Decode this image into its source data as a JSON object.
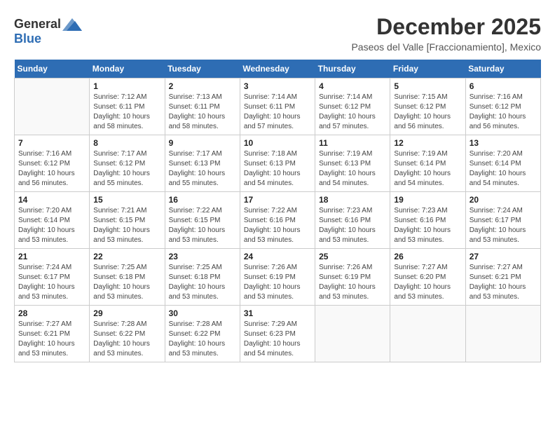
{
  "logo": {
    "general": "General",
    "blue": "Blue"
  },
  "title": "December 2025",
  "subtitle": "Paseos del Valle [Fraccionamiento], Mexico",
  "weekdays": [
    "Sunday",
    "Monday",
    "Tuesday",
    "Wednesday",
    "Thursday",
    "Friday",
    "Saturday"
  ],
  "weeks": [
    [
      {
        "day": "",
        "sunrise": "",
        "sunset": "",
        "daylight": ""
      },
      {
        "day": "1",
        "sunrise": "Sunrise: 7:12 AM",
        "sunset": "Sunset: 6:11 PM",
        "daylight": "Daylight: 10 hours and 58 minutes."
      },
      {
        "day": "2",
        "sunrise": "Sunrise: 7:13 AM",
        "sunset": "Sunset: 6:11 PM",
        "daylight": "Daylight: 10 hours and 58 minutes."
      },
      {
        "day": "3",
        "sunrise": "Sunrise: 7:14 AM",
        "sunset": "Sunset: 6:11 PM",
        "daylight": "Daylight: 10 hours and 57 minutes."
      },
      {
        "day": "4",
        "sunrise": "Sunrise: 7:14 AM",
        "sunset": "Sunset: 6:12 PM",
        "daylight": "Daylight: 10 hours and 57 minutes."
      },
      {
        "day": "5",
        "sunrise": "Sunrise: 7:15 AM",
        "sunset": "Sunset: 6:12 PM",
        "daylight": "Daylight: 10 hours and 56 minutes."
      },
      {
        "day": "6",
        "sunrise": "Sunrise: 7:16 AM",
        "sunset": "Sunset: 6:12 PM",
        "daylight": "Daylight: 10 hours and 56 minutes."
      }
    ],
    [
      {
        "day": "7",
        "sunrise": "Sunrise: 7:16 AM",
        "sunset": "Sunset: 6:12 PM",
        "daylight": "Daylight: 10 hours and 56 minutes."
      },
      {
        "day": "8",
        "sunrise": "Sunrise: 7:17 AM",
        "sunset": "Sunset: 6:12 PM",
        "daylight": "Daylight: 10 hours and 55 minutes."
      },
      {
        "day": "9",
        "sunrise": "Sunrise: 7:17 AM",
        "sunset": "Sunset: 6:13 PM",
        "daylight": "Daylight: 10 hours and 55 minutes."
      },
      {
        "day": "10",
        "sunrise": "Sunrise: 7:18 AM",
        "sunset": "Sunset: 6:13 PM",
        "daylight": "Daylight: 10 hours and 54 minutes."
      },
      {
        "day": "11",
        "sunrise": "Sunrise: 7:19 AM",
        "sunset": "Sunset: 6:13 PM",
        "daylight": "Daylight: 10 hours and 54 minutes."
      },
      {
        "day": "12",
        "sunrise": "Sunrise: 7:19 AM",
        "sunset": "Sunset: 6:14 PM",
        "daylight": "Daylight: 10 hours and 54 minutes."
      },
      {
        "day": "13",
        "sunrise": "Sunrise: 7:20 AM",
        "sunset": "Sunset: 6:14 PM",
        "daylight": "Daylight: 10 hours and 54 minutes."
      }
    ],
    [
      {
        "day": "14",
        "sunrise": "Sunrise: 7:20 AM",
        "sunset": "Sunset: 6:14 PM",
        "daylight": "Daylight: 10 hours and 53 minutes."
      },
      {
        "day": "15",
        "sunrise": "Sunrise: 7:21 AM",
        "sunset": "Sunset: 6:15 PM",
        "daylight": "Daylight: 10 hours and 53 minutes."
      },
      {
        "day": "16",
        "sunrise": "Sunrise: 7:22 AM",
        "sunset": "Sunset: 6:15 PM",
        "daylight": "Daylight: 10 hours and 53 minutes."
      },
      {
        "day": "17",
        "sunrise": "Sunrise: 7:22 AM",
        "sunset": "Sunset: 6:16 PM",
        "daylight": "Daylight: 10 hours and 53 minutes."
      },
      {
        "day": "18",
        "sunrise": "Sunrise: 7:23 AM",
        "sunset": "Sunset: 6:16 PM",
        "daylight": "Daylight: 10 hours and 53 minutes."
      },
      {
        "day": "19",
        "sunrise": "Sunrise: 7:23 AM",
        "sunset": "Sunset: 6:16 PM",
        "daylight": "Daylight: 10 hours and 53 minutes."
      },
      {
        "day": "20",
        "sunrise": "Sunrise: 7:24 AM",
        "sunset": "Sunset: 6:17 PM",
        "daylight": "Daylight: 10 hours and 53 minutes."
      }
    ],
    [
      {
        "day": "21",
        "sunrise": "Sunrise: 7:24 AM",
        "sunset": "Sunset: 6:17 PM",
        "daylight": "Daylight: 10 hours and 53 minutes."
      },
      {
        "day": "22",
        "sunrise": "Sunrise: 7:25 AM",
        "sunset": "Sunset: 6:18 PM",
        "daylight": "Daylight: 10 hours and 53 minutes."
      },
      {
        "day": "23",
        "sunrise": "Sunrise: 7:25 AM",
        "sunset": "Sunset: 6:18 PM",
        "daylight": "Daylight: 10 hours and 53 minutes."
      },
      {
        "day": "24",
        "sunrise": "Sunrise: 7:26 AM",
        "sunset": "Sunset: 6:19 PM",
        "daylight": "Daylight: 10 hours and 53 minutes."
      },
      {
        "day": "25",
        "sunrise": "Sunrise: 7:26 AM",
        "sunset": "Sunset: 6:19 PM",
        "daylight": "Daylight: 10 hours and 53 minutes."
      },
      {
        "day": "26",
        "sunrise": "Sunrise: 7:27 AM",
        "sunset": "Sunset: 6:20 PM",
        "daylight": "Daylight: 10 hours and 53 minutes."
      },
      {
        "day": "27",
        "sunrise": "Sunrise: 7:27 AM",
        "sunset": "Sunset: 6:21 PM",
        "daylight": "Daylight: 10 hours and 53 minutes."
      }
    ],
    [
      {
        "day": "28",
        "sunrise": "Sunrise: 7:27 AM",
        "sunset": "Sunset: 6:21 PM",
        "daylight": "Daylight: 10 hours and 53 minutes."
      },
      {
        "day": "29",
        "sunrise": "Sunrise: 7:28 AM",
        "sunset": "Sunset: 6:22 PM",
        "daylight": "Daylight: 10 hours and 53 minutes."
      },
      {
        "day": "30",
        "sunrise": "Sunrise: 7:28 AM",
        "sunset": "Sunset: 6:22 PM",
        "daylight": "Daylight: 10 hours and 53 minutes."
      },
      {
        "day": "31",
        "sunrise": "Sunrise: 7:29 AM",
        "sunset": "Sunset: 6:23 PM",
        "daylight": "Daylight: 10 hours and 54 minutes."
      },
      {
        "day": "",
        "sunrise": "",
        "sunset": "",
        "daylight": ""
      },
      {
        "day": "",
        "sunrise": "",
        "sunset": "",
        "daylight": ""
      },
      {
        "day": "",
        "sunrise": "",
        "sunset": "",
        "daylight": ""
      }
    ]
  ]
}
